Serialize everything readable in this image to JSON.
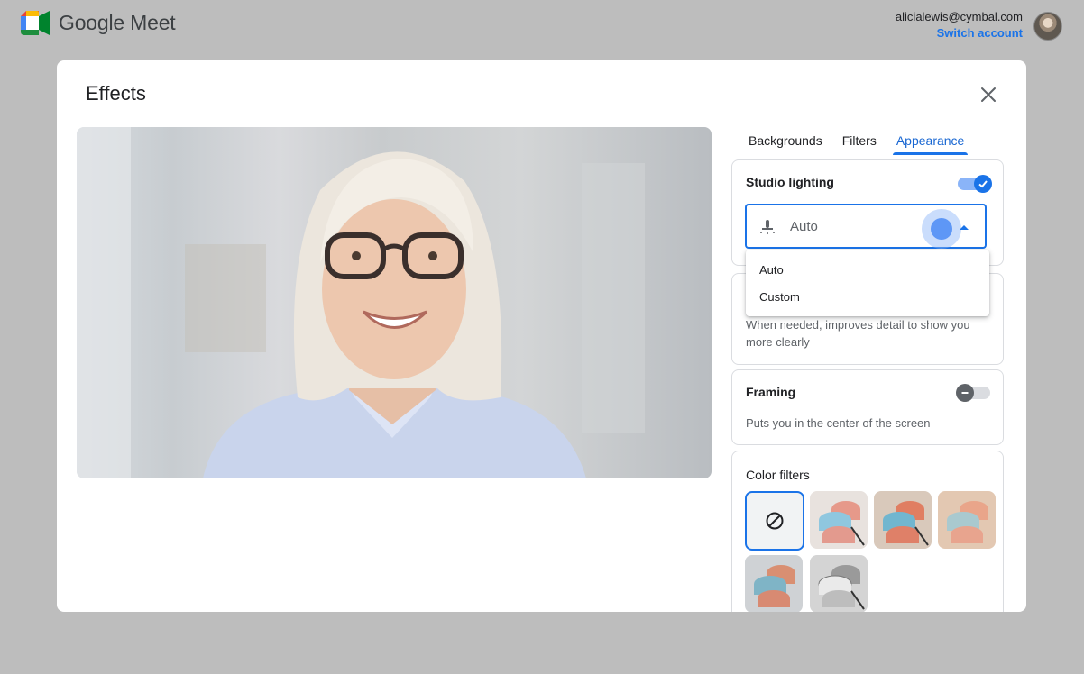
{
  "app": {
    "name": "Google Meet"
  },
  "account": {
    "email": "alicialewis@cymbal.com",
    "switch_label": "Switch account"
  },
  "dialog": {
    "title": "Effects",
    "tabs": [
      {
        "label": "Backgrounds",
        "active": false
      },
      {
        "label": "Filters",
        "active": false
      },
      {
        "label": "Appearance",
        "active": true
      }
    ],
    "studio_lighting": {
      "title": "Studio lighting",
      "enabled": true,
      "select_value": "Auto",
      "options": [
        "Auto",
        "Custom"
      ]
    },
    "low_light": {
      "title_partial": "S",
      "description": "When needed, improves detail to show you more clearly"
    },
    "framing": {
      "title": "Framing",
      "enabled": false,
      "description": "Puts you in the center of the screen"
    },
    "color_filters": {
      "title": "Color filters",
      "selected": "none",
      "icons": {
        "none": "no-filter-icon"
      }
    }
  },
  "colors": {
    "accent": "#1a73e8",
    "backdrop": "#bdbdbd"
  }
}
